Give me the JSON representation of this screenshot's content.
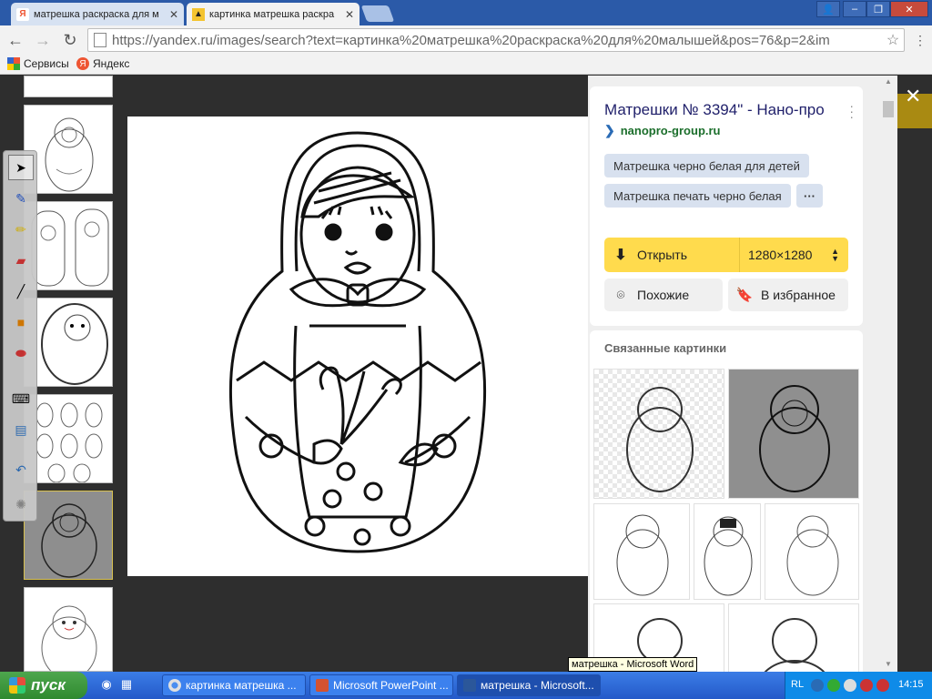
{
  "tabs": [
    {
      "title": "матрешка раскраска для м",
      "favicon": "Я",
      "active": false
    },
    {
      "title": "картинка матрешка раскра",
      "favicon": "image-icon",
      "active": true
    }
  ],
  "window_controls": {
    "user": "👤",
    "minimize": "–",
    "maximize": "❐",
    "close": "✕"
  },
  "nav": {
    "back": "←",
    "forward": "→",
    "reload": "↻"
  },
  "address": {
    "url": "https://yandex.ru/images/search?text=картинка%20матрешка%20раскраска%20для%20малышей&pos=76&p=2&im"
  },
  "bookmarks": [
    {
      "label": "Сервисы",
      "icon": "apps-grid-icon"
    },
    {
      "label": "Яндекс",
      "icon": "yandex-icon"
    }
  ],
  "panel": {
    "title": "Матрешки № 3394\" - Нано-про",
    "site": "nanopro-group.ru",
    "chips": [
      "Матрешка черно белая для детей",
      "Матрешка печать черно белая"
    ],
    "more_chip": "···",
    "open_label": "Открыть",
    "size": "1280×1280",
    "similar_label": "Похожие",
    "favorite_label": "В избранное",
    "related_title": "Связанные картинки"
  },
  "tooltip": "матрешка - Microsoft Word",
  "taskbar": {
    "start_label": "пуск",
    "tasks": [
      {
        "label": "картинка матрешка ...",
        "active": false,
        "color": "#e0e0e0"
      },
      {
        "label": "Microsoft PowerPoint ...",
        "active": false,
        "color": "#d35230"
      },
      {
        "label": "матрешка - Microsoft...",
        "active": true,
        "color": "#2b579a"
      }
    ],
    "lang": "RL",
    "clock": "14:15"
  },
  "colors": {
    "yandex_yellow": "#ffdb4d",
    "site_green": "#1b6e2b",
    "xp_taskbar": "#2459c9"
  }
}
